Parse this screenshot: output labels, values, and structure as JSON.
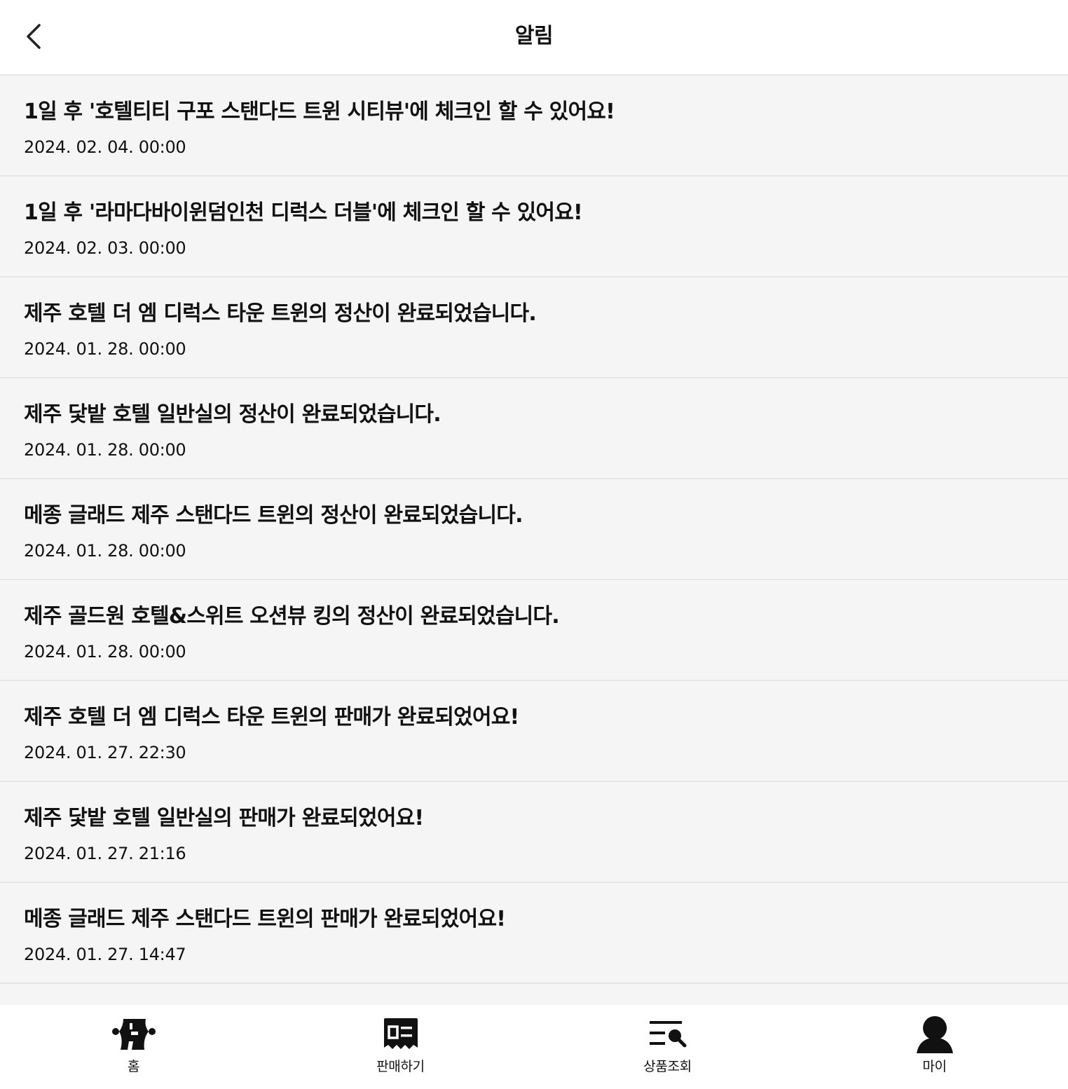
{
  "header": {
    "title": "알림",
    "back_icon": "chevron-left-icon"
  },
  "notifications": [
    {
      "title": "1일 후 '호텔티티 구포 스탠다드 트윈 시티뷰'에 체크인 할 수 있어요!",
      "date": "2024. 02. 04. 00:00"
    },
    {
      "title": "1일 후 '라마다바이윈덤인천 디럭스 더블'에 체크인 할 수 있어요!",
      "date": "2024. 02. 03. 00:00"
    },
    {
      "title": "제주 호텔 더 엠 디럭스 타운 트윈의 정산이 완료되었습니다.",
      "date": "2024. 01. 28. 00:00"
    },
    {
      "title": "제주 닻밭 호텔 일반실의 정산이 완료되었습니다.",
      "date": "2024. 01. 28. 00:00"
    },
    {
      "title": "메종 글래드 제주 스탠다드 트윈의 정산이 완료되었습니다.",
      "date": "2024. 01. 28. 00:00"
    },
    {
      "title": "제주 골드원 호텔&스위트 오션뷰 킹의 정산이 완료되었습니다.",
      "date": "2024. 01. 28. 00:00"
    },
    {
      "title": "제주 호텔 더 엠 디럭스 타운 트윈의 판매가 완료되었어요!",
      "date": "2024. 01. 27. 22:30"
    },
    {
      "title": "제주 닻밭 호텔 일반실의 판매가 완료되었어요!",
      "date": "2024. 01. 27. 21:16"
    },
    {
      "title": "메종 글래드 제주 스탠다드 트윈의 판매가 완료되었어요!",
      "date": "2024. 01. 27. 14:47"
    }
  ],
  "tabbar": {
    "items": [
      {
        "label": "홈",
        "icon": "ticket-icon"
      },
      {
        "label": "판매하기",
        "icon": "sell-receipt-icon"
      },
      {
        "label": "상품조회",
        "icon": "list-search-icon"
      },
      {
        "label": "마이",
        "icon": "person-icon"
      }
    ]
  }
}
